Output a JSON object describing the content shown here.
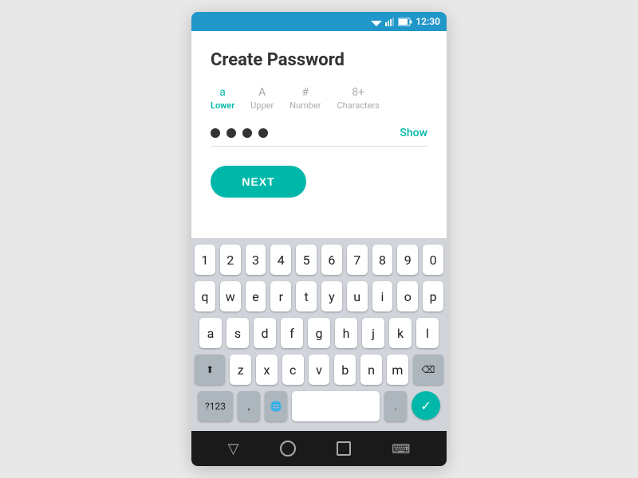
{
  "statusBar": {
    "time": "12:30"
  },
  "page": {
    "title": "Create Password"
  },
  "requirements": [
    {
      "symbol": "a",
      "label": "Lower",
      "active": true
    },
    {
      "symbol": "A",
      "label": "Upper",
      "active": false
    },
    {
      "symbol": "#",
      "label": "Number",
      "active": false
    },
    {
      "symbol": "8+",
      "label": "Characters",
      "active": false
    }
  ],
  "passwordField": {
    "dots": 4,
    "showLabel": "Show"
  },
  "nextButton": {
    "label": "NEXT"
  },
  "keyboard": {
    "row1": [
      "1",
      "2",
      "3",
      "4",
      "5",
      "6",
      "7",
      "8",
      "9",
      "0"
    ],
    "row2": [
      "q",
      "w",
      "e",
      "r",
      "t",
      "y",
      "u",
      "i",
      "o",
      "p"
    ],
    "row3": [
      "a",
      "s",
      "d",
      "f",
      "g",
      "h",
      "j",
      "k",
      "l"
    ],
    "row4": [
      "z",
      "x",
      "c",
      "v",
      "b",
      "n",
      "m"
    ],
    "bottomLeft": "?123",
    "comma": ",",
    "period": ".",
    "checkmark": "✓"
  },
  "bottomNav": {
    "back": "▽",
    "home": "○",
    "recent": "□",
    "keyboard": "⌨"
  }
}
